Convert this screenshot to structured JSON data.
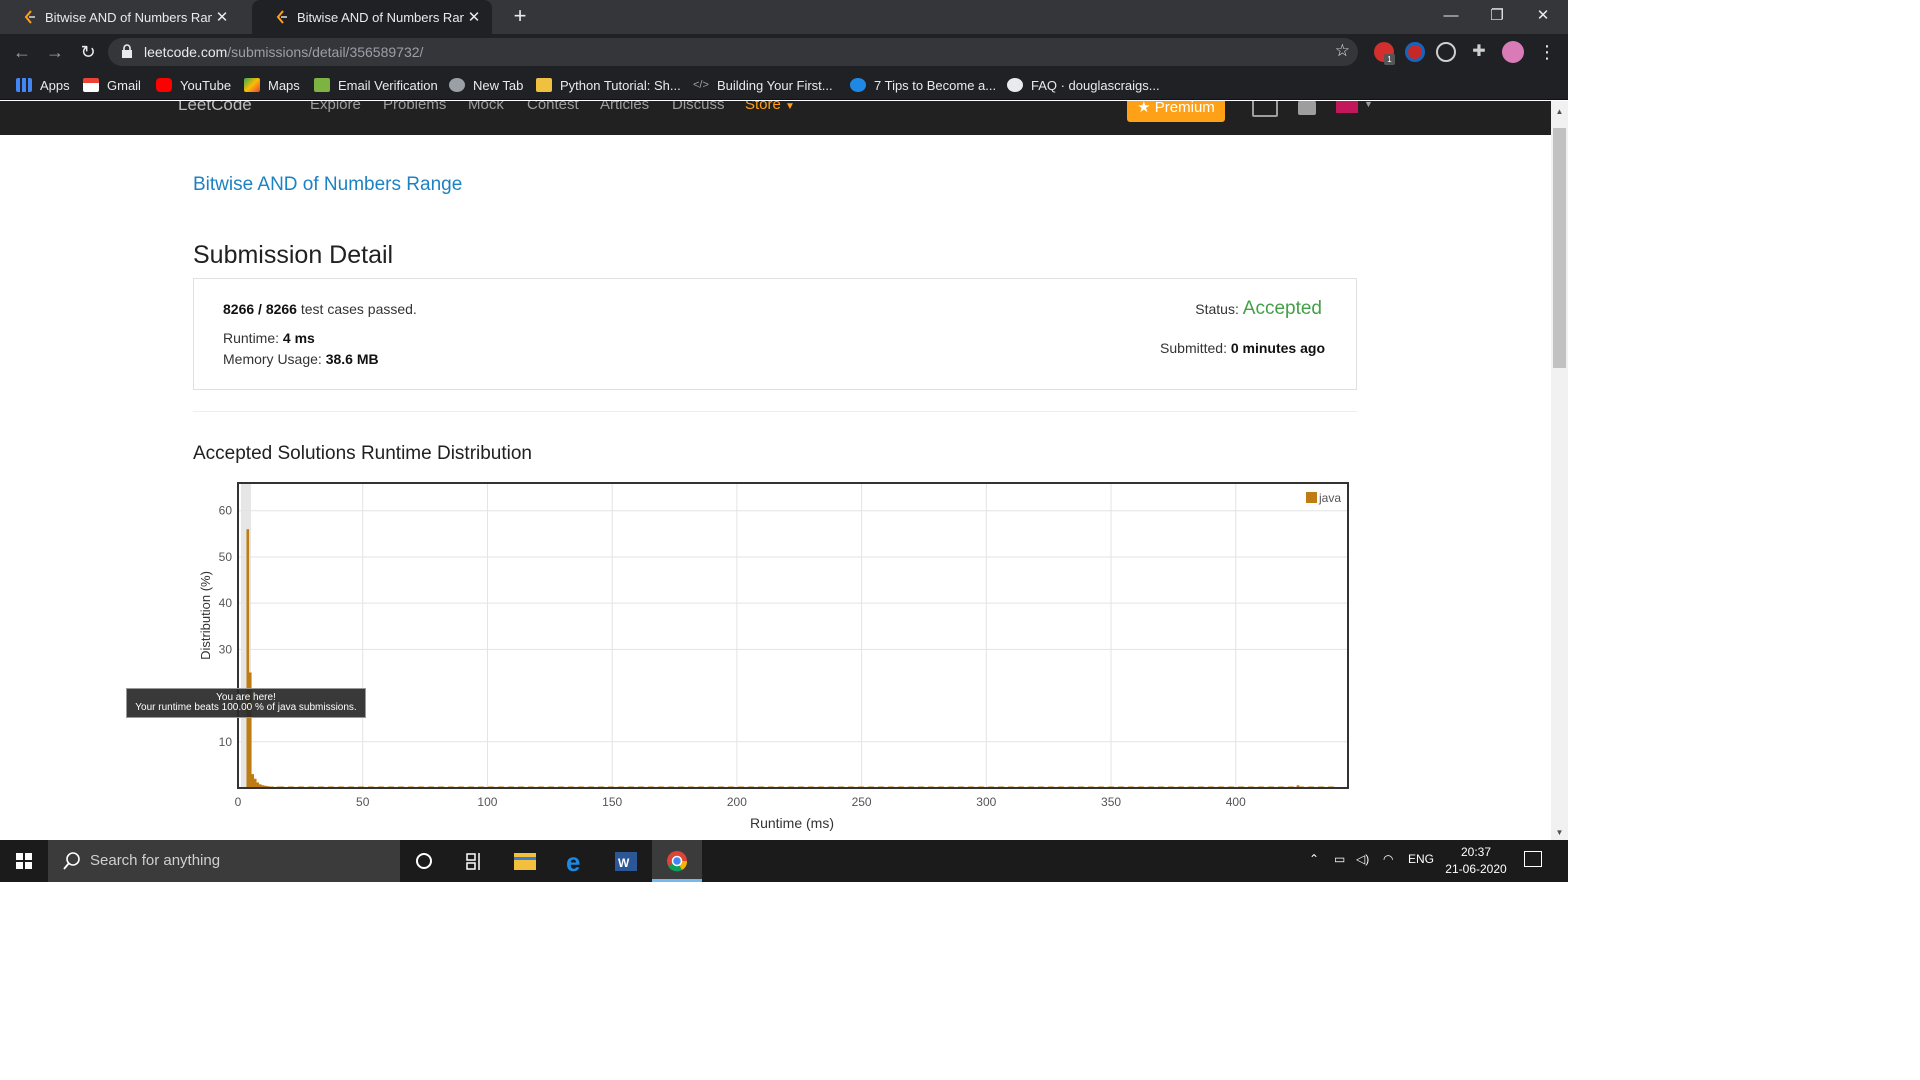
{
  "browser": {
    "tabs": [
      {
        "title": "Bitwise AND of Numbers Range",
        "close": "✕"
      },
      {
        "title": "Bitwise AND of Numbers Range",
        "close": "✕"
      }
    ],
    "new_tab": "+",
    "window_controls": {
      "minimize": "—",
      "restore": "❐",
      "close": "✕"
    },
    "url_domain": "leetcode.com",
    "url_path": "/submissions/detail/356589732/",
    "extension_badge": "1",
    "bookmarks": [
      {
        "label": "Apps",
        "icon": "apps-grid-icon"
      },
      {
        "label": "Gmail",
        "icon": "gmail-icon"
      },
      {
        "label": "YouTube",
        "icon": "youtube-icon"
      },
      {
        "label": "Maps",
        "icon": "maps-icon"
      },
      {
        "label": "Email Verification",
        "icon": "site-icon"
      },
      {
        "label": "New Tab",
        "icon": "globe-icon"
      },
      {
        "label": "Python Tutorial: Sh...",
        "icon": "site-icon"
      },
      {
        "label": "Building Your First...",
        "icon": "code-icon"
      },
      {
        "label": "7 Tips to Become a...",
        "icon": "globe-icon"
      },
      {
        "label": "FAQ · douglascraigs...",
        "icon": "github-icon"
      }
    ]
  },
  "site_nav": {
    "logo": "LeetCode",
    "items": [
      "Explore",
      "Problems",
      "Mock",
      "Contest",
      "Articles",
      "Discuss"
    ],
    "store": "Store",
    "premium": "Premium"
  },
  "page": {
    "problem_title": "Bitwise AND of Numbers Range",
    "heading": "Submission Detail",
    "passed": "8266",
    "sep": "/",
    "total": "8266",
    "passed_suffix": "test cases passed.",
    "runtime_label": "Runtime:",
    "runtime_value": "4 ms",
    "memory_label": "Memory Usage:",
    "memory_value": "38.6 MB",
    "status_label": "Status:",
    "status_value": "Accepted",
    "submitted_label": "Submitted:",
    "submitted_value": "0 minutes ago",
    "dist_heading": "Accepted Solutions Runtime Distribution",
    "tooltip_line1": "You are here!",
    "tooltip_line2": "Your runtime beats 100.00 % of java submissions."
  },
  "colors": {
    "accent_green": "#43a047",
    "link_blue": "#1c82c3",
    "bar": "#c07c14",
    "premium": "#ffa116"
  },
  "chart_data": {
    "type": "bar",
    "xlabel": "Runtime (ms)",
    "ylabel": "Distribution (%)",
    "legend": [
      "java"
    ],
    "legend_position": "top-right",
    "xlim": [
      0,
      445
    ],
    "ylim": [
      0,
      66
    ],
    "xticks": [
      0,
      50,
      100,
      150,
      200,
      250,
      300,
      350,
      400
    ],
    "yticks": [
      10,
      30,
      40,
      50,
      60
    ],
    "grid": true,
    "highlight_x": 4,
    "series": [
      {
        "name": "java",
        "x": [
          4,
          5,
          6,
          7,
          8,
          9,
          10,
          11,
          12,
          14,
          16,
          18,
          20,
          25,
          30,
          40,
          50,
          60,
          80,
          100,
          120,
          150,
          170,
          200,
          250,
          300,
          350,
          400,
          425,
          435
        ],
        "values": [
          56,
          25,
          3,
          2,
          1.2,
          0.8,
          0.6,
          0.5,
          0.4,
          0.3,
          0.3,
          0.25,
          0.2,
          0.2,
          0.2,
          0.15,
          0.15,
          0.1,
          0.1,
          0.1,
          0.1,
          0.1,
          0.1,
          0.1,
          0.1,
          0.1,
          0.1,
          0.1,
          0.6,
          0.3
        ]
      }
    ]
  },
  "taskbar": {
    "search_placeholder": "Search for anything",
    "lang": "ENG",
    "time": "20:37",
    "date": "21-06-2020"
  }
}
